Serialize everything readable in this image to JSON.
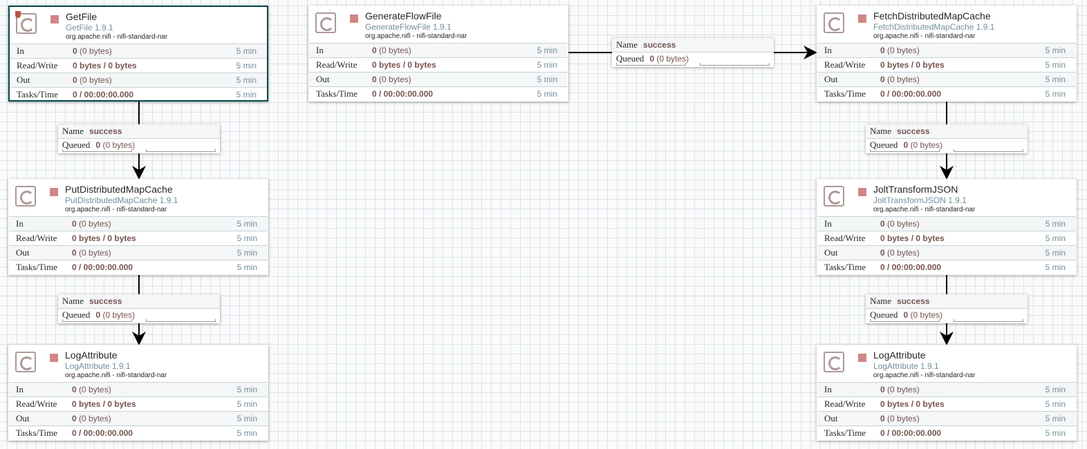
{
  "labels": {
    "in": "In",
    "rw": "Read/Write",
    "out": "Out",
    "tasks": "Tasks/Time",
    "name": "Name",
    "queued": "Queued"
  },
  "processors": [
    {
      "name": "GetFile",
      "type": "GetFile 1.9.1",
      "bundle": "org.apache.nifi - nifi-standard-nar",
      "selected": true,
      "restricted": true,
      "in_count": "0",
      "in_size": "(0 bytes)",
      "rw": "0 bytes / 0 bytes",
      "out_count": "0",
      "out_size": "(0 bytes)",
      "tasks": "0 / 00:00:00.000",
      "window": "5 min"
    },
    {
      "name": "GenerateFlowFile",
      "type": "GenerateFlowFile 1.9.1",
      "bundle": "org.apache.nifi - nifi-standard-nar",
      "in_count": "0",
      "in_size": "(0 bytes)",
      "rw": "0 bytes / 0 bytes",
      "out_count": "0",
      "out_size": "(0 bytes)",
      "tasks": "0 / 00:00:00.000",
      "window": "5 min"
    },
    {
      "name": "FetchDistributedMapCache",
      "type": "FetchDistributedMapCache 1.9.1",
      "bundle": "org.apache.nifi - nifi-standard-nar",
      "in_count": "0",
      "in_size": "(0 bytes)",
      "rw": "0 bytes / 0 bytes",
      "out_count": "0",
      "out_size": "(0 bytes)",
      "tasks": "0 / 00:00:00.000",
      "window": "5 min"
    },
    {
      "name": "PutDistributedMapCache",
      "type": "PutDistributedMapCache 1.9.1",
      "bundle": "org.apache.nifi - nifi-standard-nar",
      "in_count": "0",
      "in_size": "(0 bytes)",
      "rw": "0 bytes / 0 bytes",
      "out_count": "0",
      "out_size": "(0 bytes)",
      "tasks": "0 / 00:00:00.000",
      "window": "5 min"
    },
    {
      "name": "JoltTransformJSON",
      "type": "JoltTransformJSON 1.9.1",
      "bundle": "org.apache.nifi - nifi-standard-nar",
      "in_count": "0",
      "in_size": "(0 bytes)",
      "rw": "0 bytes / 0 bytes",
      "out_count": "0",
      "out_size": "(0 bytes)",
      "tasks": "0 / 00:00:00.000",
      "window": "5 min"
    },
    {
      "name": "LogAttribute",
      "type": "LogAttribute 1.9.1",
      "bundle": "org.apache.nifi - nifi-standard-nar",
      "in_count": "0",
      "in_size": "(0 bytes)",
      "rw": "0 bytes / 0 bytes",
      "out_count": "0",
      "out_size": "(0 bytes)",
      "tasks": "0 / 00:00:00.000",
      "window": "5 min"
    },
    {
      "name": "LogAttribute",
      "type": "LogAttribute 1.9.1",
      "bundle": "org.apache.nifi - nifi-standard-nar",
      "in_count": "0",
      "in_size": "(0 bytes)",
      "rw": "0 bytes / 0 bytes",
      "out_count": "0",
      "out_size": "(0 bytes)",
      "tasks": "0 / 00:00:00.000",
      "window": "5 min"
    }
  ],
  "connections": [
    {
      "from": "GetFile",
      "to": "PutDistributedMapCache",
      "name": "success",
      "queued_count": "0",
      "queued_size": "(0 bytes)"
    },
    {
      "from": "PutDistributedMapCache",
      "to": "LogAttribute",
      "name": "success",
      "queued_count": "0",
      "queued_size": "(0 bytes)"
    },
    {
      "from": "GenerateFlowFile",
      "to": "FetchDistributedMapCache",
      "name": "success",
      "queued_count": "0",
      "queued_size": "(0 bytes)"
    },
    {
      "from": "FetchDistributedMapCache",
      "to": "JoltTransformJSON",
      "name": "success",
      "queued_count": "0",
      "queued_size": "(0 bytes)"
    },
    {
      "from": "JoltTransformJSON",
      "to": "LogAttribute",
      "name": "success",
      "queued_count": "0",
      "queued_size": "(0 bytes)"
    }
  ]
}
